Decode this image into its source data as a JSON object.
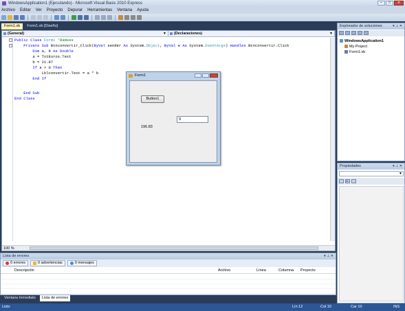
{
  "window": {
    "title": "WindowsApplication1 (Ejecutando) - Microsoft Visual Basic 2010 Express"
  },
  "menu": [
    "Archivo",
    "Editar",
    "Ver",
    "Proyecto",
    "Depurar",
    "Herramientas",
    "Ventana",
    "Ayuda"
  ],
  "tabs": [
    "Form1.vb",
    "Form1.vb [Diseño]"
  ],
  "editor": {
    "combo_left": "(General)",
    "combo_right": "(Declaraciones)",
    "zoom": "100 %",
    "code": {
      "l1a": "Public Class",
      "l1b": " Form1",
      "l1c": " 'Ramses",
      "l2a": "    Private Sub",
      "l2b": " Btnconvertir_Click(",
      "l2c": "ByVal",
      "l2d": " sender ",
      "l2e": "As",
      "l2f": " System.",
      "l2g": "Object",
      "l2h": ", ",
      "l2i": "ByVal",
      "l2j": " e ",
      "l2k": "As",
      "l2l": " System.",
      "l2m": "EventArgs",
      "l2n": ") ",
      "l2o": "Handles",
      "l2p": " Btnconvertir.Click",
      "l3a": "        Dim",
      "l3b": " a, b ",
      "l3c": "As Double",
      "l4": "        a = TxtEuros.Text",
      "l5": "        b = 21.87",
      "l6a": "        If",
      "l6b": " a > 0 ",
      "l6c": "Then",
      "l7": "            Lblconvertir.Text = a * b",
      "l8": "        End If",
      "l9": "    End Sub",
      "l10": "End Class"
    }
  },
  "form1": {
    "title": "Form1",
    "button": "Button1",
    "textbox": "9",
    "label": "196.83"
  },
  "solution_explorer": {
    "title": "Explorador de soluciones",
    "project": "WindowsApplication1",
    "items": [
      "My Project",
      "Form1.vb"
    ]
  },
  "properties": {
    "title": "Propiedades"
  },
  "error_list": {
    "title": "Lista de errores",
    "errors": "0 errores",
    "warnings": "0 advertencias",
    "messages": "0 mensajes",
    "columns": [
      "Descripción",
      "Archivo",
      "Línea",
      "Columna",
      "Proyecto"
    ]
  },
  "bottom_tabs": [
    "Ventana Inmediato",
    "Lista de errores"
  ],
  "status": {
    "ready": "Listo",
    "line": "Lín 12",
    "col": "Col 10",
    "char": "Car 10",
    "ins": "INS"
  },
  "colors": {
    "ide_bg": "#2b3c59",
    "keyword": "#0000ff",
    "type": "#2b91af",
    "comment": "#008000",
    "status_bar": "#2b5797"
  },
  "icons": [
    "app-icon",
    "close-icon",
    "pin-icon",
    "error-icon",
    "warning-icon",
    "info-icon",
    "folder-icon",
    "vb-file-icon"
  ]
}
